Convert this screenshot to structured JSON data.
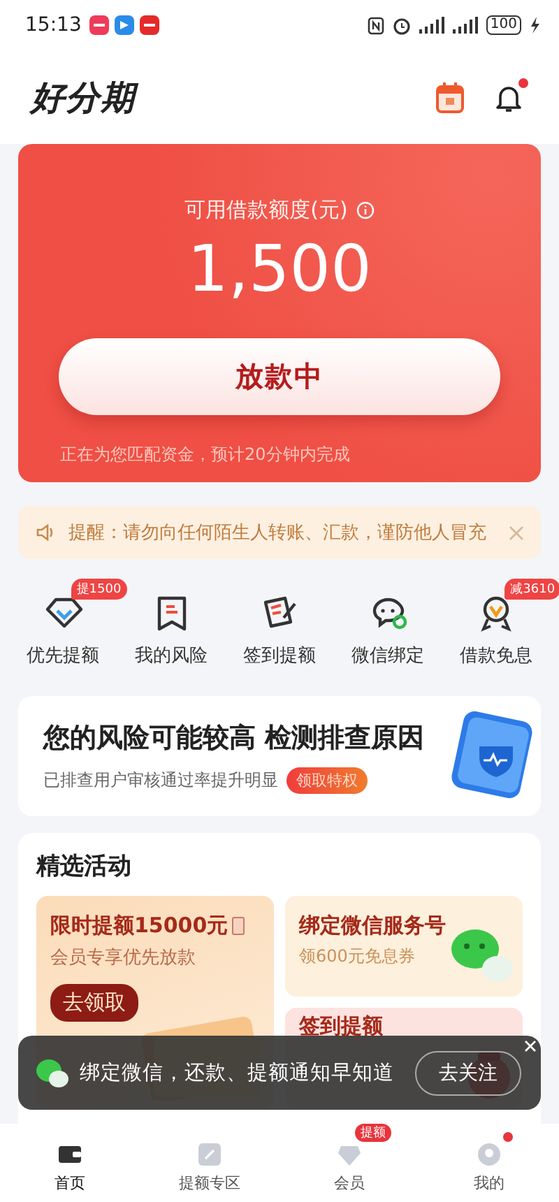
{
  "status_bar": {
    "time": "15:13",
    "battery": "100"
  },
  "header": {
    "logo": "好分期",
    "bell_dot": true
  },
  "loan_card": {
    "label": "可用借款额度(元)",
    "amount": "1,500",
    "button": "放款中",
    "note": "正在为您匹配资金，预计20分钟内完成"
  },
  "notice": {
    "text": "提醒：请勿向任何陌生人转账、汇款，谨防他人冒充"
  },
  "quick_actions": [
    {
      "label": "优先提额",
      "badge": "提1500"
    },
    {
      "label": "我的风险"
    },
    {
      "label": "签到提额"
    },
    {
      "label": "微信绑定"
    },
    {
      "label": "借款免息",
      "badge": "减3610"
    }
  ],
  "risk_banner": {
    "title": "您的风险可能较高 检测排查原因",
    "subtitle": "已排查用户审核通过率提升明显",
    "button": "领取特权"
  },
  "activities": {
    "title": "精选活动",
    "tiles": [
      {
        "kind": "large",
        "title": "限时提额15000元",
        "subtitle": "会员专享优先放款",
        "button": "去领取"
      },
      {
        "kind": "wechat",
        "title": "绑定微信服务号",
        "subtitle": "领600元免息券"
      },
      {
        "kind": "gift",
        "title": "签到提额"
      }
    ]
  },
  "toast": {
    "text": "绑定微信，还款、提额通知早知道",
    "button": "去关注"
  },
  "tabs": [
    {
      "label": "首页",
      "selected": true,
      "dot": false
    },
    {
      "label": "提额专区",
      "selected": false,
      "dot": false
    },
    {
      "label": "会员",
      "selected": false,
      "dot": false,
      "badge": "提额"
    },
    {
      "label": "我的",
      "selected": false,
      "dot": true
    }
  ]
}
